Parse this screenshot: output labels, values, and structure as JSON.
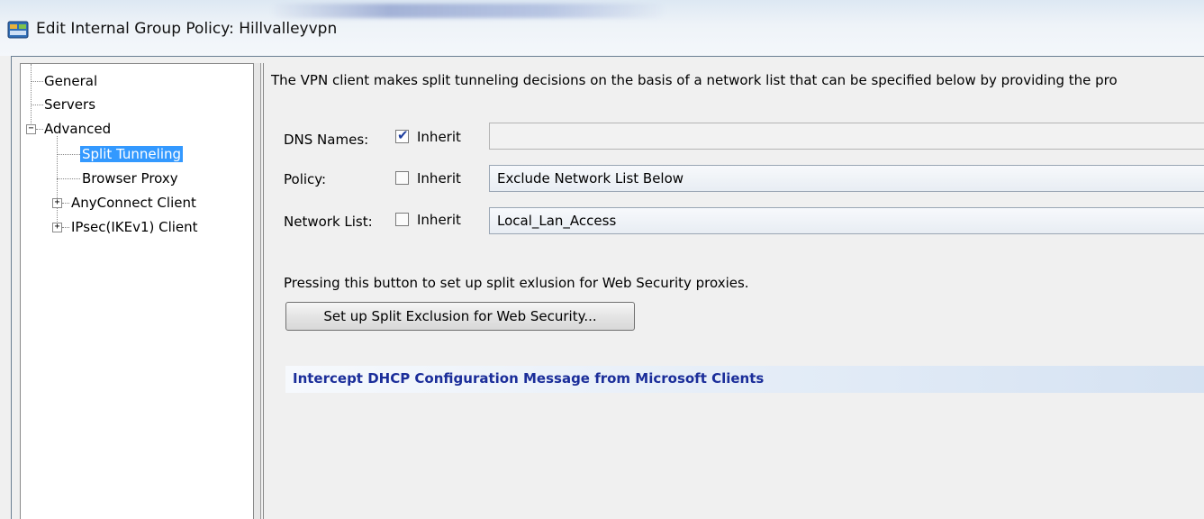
{
  "window": {
    "title": "Edit Internal Group Policy: Hillvalleyvpn",
    "icon": "group-policy-icon"
  },
  "tree": {
    "items": [
      {
        "label": "General",
        "level": 0,
        "expander": null,
        "selected": false
      },
      {
        "label": "Servers",
        "level": 0,
        "expander": null,
        "selected": false
      },
      {
        "label": "Advanced",
        "level": 0,
        "expander": "minus",
        "selected": false
      },
      {
        "label": "Split Tunneling",
        "level": 1,
        "expander": null,
        "selected": true
      },
      {
        "label": "Browser Proxy",
        "level": 1,
        "expander": null,
        "selected": false
      },
      {
        "label": "AnyConnect Client",
        "level": 1,
        "expander": "plus",
        "selected": false
      },
      {
        "label": "IPsec(IKEv1) Client",
        "level": 1,
        "expander": "plus",
        "selected": false
      }
    ]
  },
  "content": {
    "intro": "The VPN client makes split tunneling decisions on the basis of a network list that can be specified below by providing the pro",
    "rows": [
      {
        "label": "DNS Names:",
        "inherit_label": "Inherit",
        "inherit_checked": true,
        "value": ""
      },
      {
        "label": "Policy:",
        "inherit_label": "Inherit",
        "inherit_checked": false,
        "value": "Exclude Network List Below"
      },
      {
        "label": "Network List:",
        "inherit_label": "Inherit",
        "inherit_checked": false,
        "value": "Local_Lan_Access"
      }
    ],
    "note": "Pressing this button to set up split exlusion for Web Security proxies.",
    "button_label": "Set up Split Exclusion for Web Security...",
    "section_header": "Intercept DHCP Configuration Message from Microsoft Clients"
  },
  "colors": {
    "selection": "#3399ff",
    "section_header_text": "#1b2e9a"
  }
}
